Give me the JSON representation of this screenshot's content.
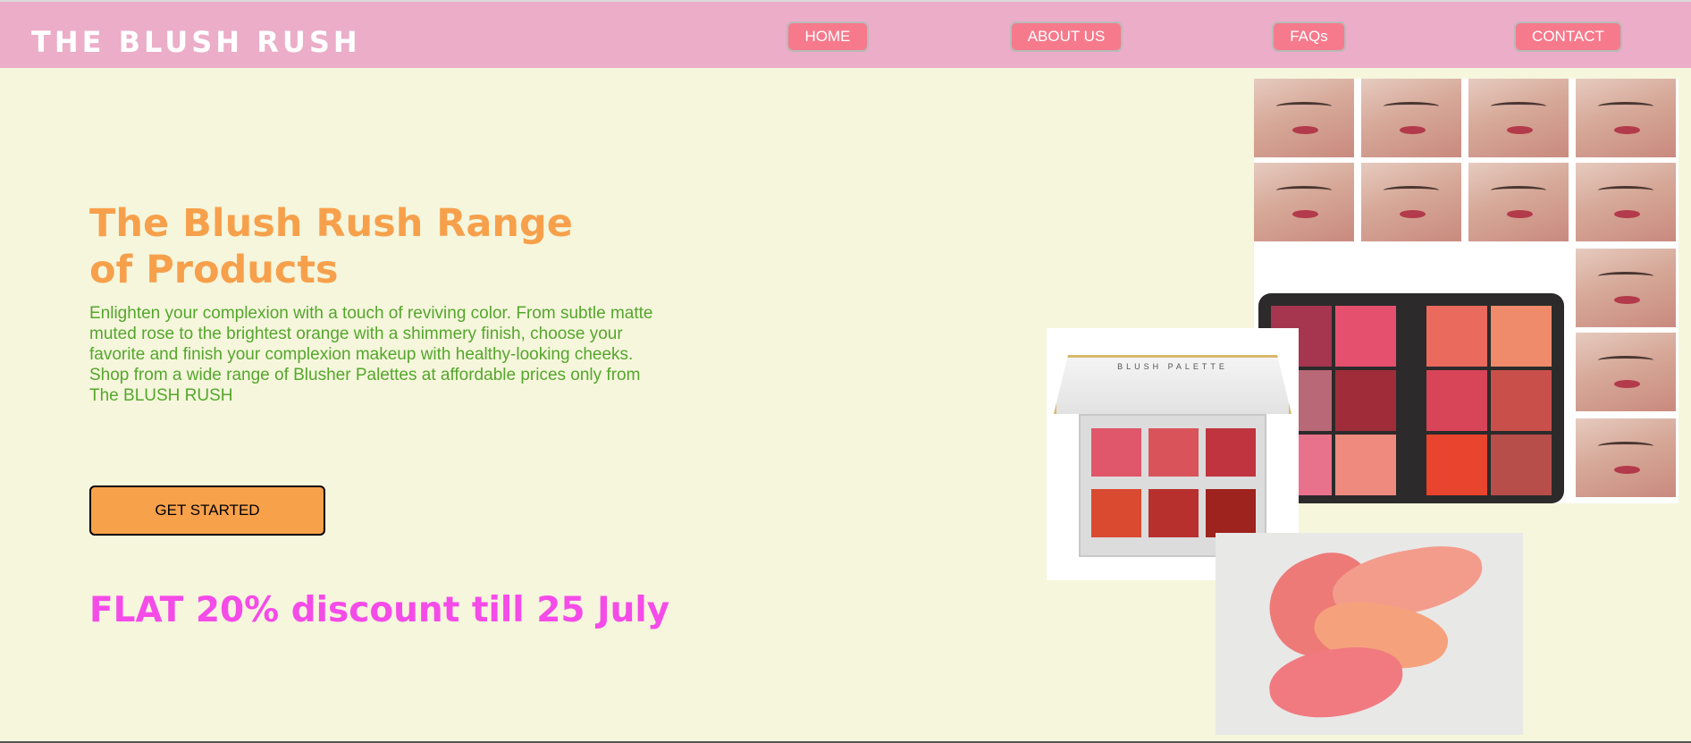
{
  "header": {
    "brand": "THE BLUSH RUSH",
    "nav": [
      {
        "label": "HOME"
      },
      {
        "label": "ABOUT US"
      },
      {
        "label": "FAQs"
      },
      {
        "label": "CONTACT"
      }
    ]
  },
  "hero": {
    "title": "The Blush Rush Range of Products",
    "description": "Enlighten your complexion with a touch of reviving color. From subtle matte muted rose to the brightest orange with a shimmery finish, choose your favorite and finish your complexion makeup with healthy-looking cheeks. Shop from a wide range of Blusher Palettes at affordable prices only from The BLUSH RUSH",
    "cta_label": "GET STARTED",
    "promo": "FLAT 20% discount till 25 July"
  },
  "images": {
    "small_palette_label": "BLUSH PALETTE"
  },
  "colors": {
    "background": "#f5f6dc",
    "header": "#ebadc8",
    "nav_button": "#f67a8c",
    "title": "#f7a04c",
    "description": "#55a62c",
    "cta": "#f7a14b",
    "promo": "#f54be8"
  }
}
